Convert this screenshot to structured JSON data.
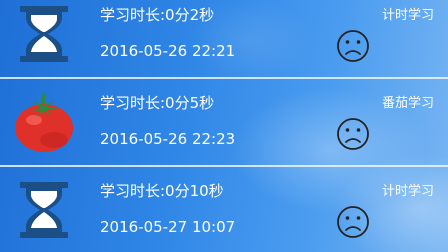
{
  "records": [
    {
      "icon": "hourglass-icon",
      "duration_text": "学习时长:0分2秒",
      "datetime_text": "2016-05-26 22:21",
      "mode_label": "计时学习",
      "mood_icon": "sad-face-icon"
    },
    {
      "icon": "tomato-icon",
      "duration_text": "学习时长:0分5秒",
      "datetime_text": "2016-05-26 22:23",
      "mode_label": "番茄学习",
      "mood_icon": "sad-face-icon"
    },
    {
      "icon": "hourglass-icon",
      "duration_text": "学习时长:0分10秒",
      "datetime_text": "2016-05-27 10:07",
      "mode_label": "计时学习",
      "mood_icon": "sad-face-icon"
    }
  ],
  "colors": {
    "background_start": "#1f6fd6",
    "background_end": "#7ab6f2",
    "text": "#ffffff",
    "hourglass_frame": "#1b4f86",
    "hourglass_sand": "#ffffff",
    "tomato_body": "#e0302a",
    "tomato_leaf": "#2e8b3a",
    "mood_face": "#222222"
  }
}
